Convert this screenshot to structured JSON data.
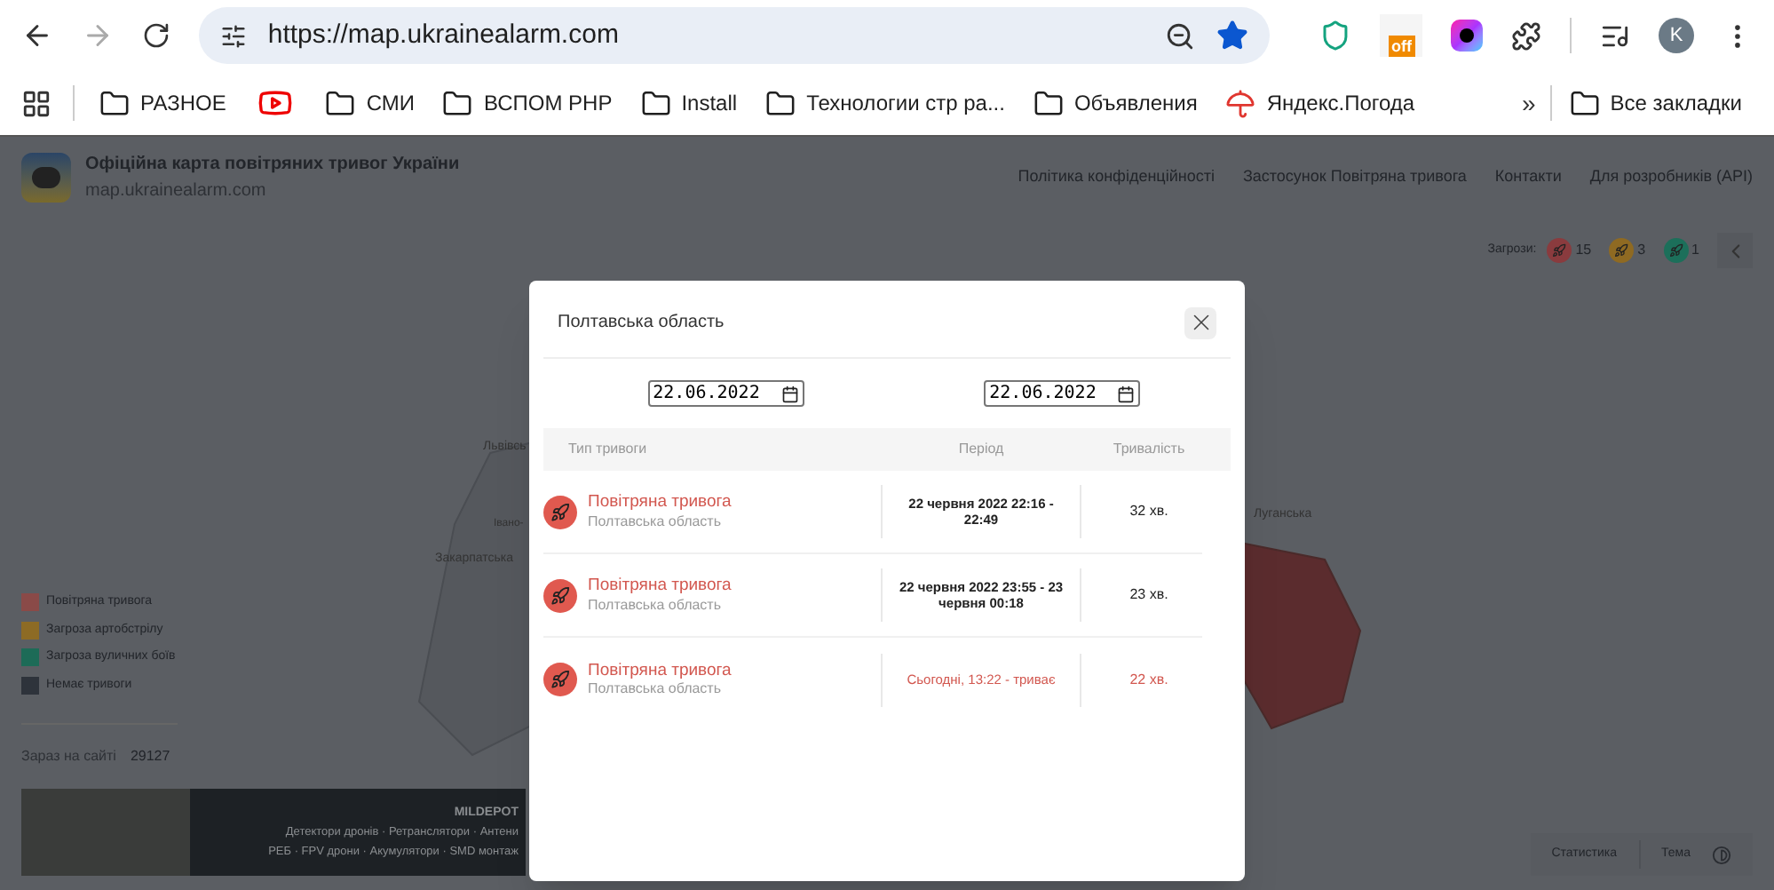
{
  "browser": {
    "back_disabled": false,
    "forward_disabled": true,
    "url": "https://map.ukrainealarm.com",
    "starred": true,
    "extension_badge": "off",
    "profile": "K",
    "bookmarks": [
      {
        "kind": "folder",
        "label": "РАЗНОЕ"
      },
      {
        "kind": "video"
      },
      {
        "kind": "folder",
        "label": "СМИ"
      },
      {
        "kind": "folder",
        "label": "ВСПОМ PHP"
      },
      {
        "kind": "folder",
        "label": "Install"
      },
      {
        "kind": "folder",
        "label": "Технологии стр ра..."
      },
      {
        "kind": "folder",
        "label": "Объявления"
      },
      {
        "kind": "weather",
        "label": "Яндекс.Погода"
      }
    ],
    "more_bookmarks": "»",
    "all_bookmarks": "Все закладки"
  },
  "header": {
    "title": "Офіційна карта повітряних тривог України",
    "subtitle": "map.ukrainealarm.com",
    "nav": [
      "Політика конфіденційності",
      "Застосунок Повітряна тривога",
      "Контакти",
      "Для розробників (API)"
    ]
  },
  "threats": {
    "label": "Загрози:",
    "items": [
      {
        "count": "15",
        "color": "#8a3b3e"
      },
      {
        "count": "3",
        "color": "#8f6a22"
      },
      {
        "count": "1",
        "color": "#1c6f5a"
      }
    ]
  },
  "map_labels": [
    "Львівсь",
    "Івано-",
    "Закарпатська",
    "Луганська"
  ],
  "legend": [
    {
      "label": "Повітряна тривога",
      "color": "#8a4a48"
    },
    {
      "label": "Загроза артобстрілу",
      "color": "#8d6b25"
    },
    {
      "label": "Загроза вуличних боїв",
      "color": "#1d6b57"
    },
    {
      "label": "Немає тривоги",
      "color": "#2e333b"
    }
  ],
  "online": {
    "label": "Зараз на сайті",
    "value": "29127"
  },
  "ad": {
    "brand": "MILDEPOT",
    "lines": [
      "Детектори дронів · Ретранслятори · Антени",
      "РЕБ · FPV дрони · Акумулятори · SMD монтаж"
    ]
  },
  "footer": {
    "stats": "Статистика",
    "theme": "Тема"
  },
  "modal": {
    "title": "Полтавська область",
    "dates": [
      "22.06.2022",
      "22.06.2022"
    ],
    "columns": [
      "Тип тривоги",
      "Період",
      "Тривалість"
    ],
    "rows": [
      {
        "title": "Повітряна тривога",
        "region": "Полтавська область",
        "period": "22 червня 2022 22:16 - 22:49",
        "duration": "32 хв.",
        "ongoing": false
      },
      {
        "title": "Повітряна тривога",
        "region": "Полтавська область",
        "period": "22 червня 2022 23:55 - 23 червня 00:18",
        "duration": "23 хв.",
        "ongoing": false
      },
      {
        "title": "Повітряна тривога",
        "region": "Полтавська область",
        "period": "Сьогодні, 13:22 - триває",
        "duration": "22 хв.",
        "ongoing": true
      }
    ]
  }
}
